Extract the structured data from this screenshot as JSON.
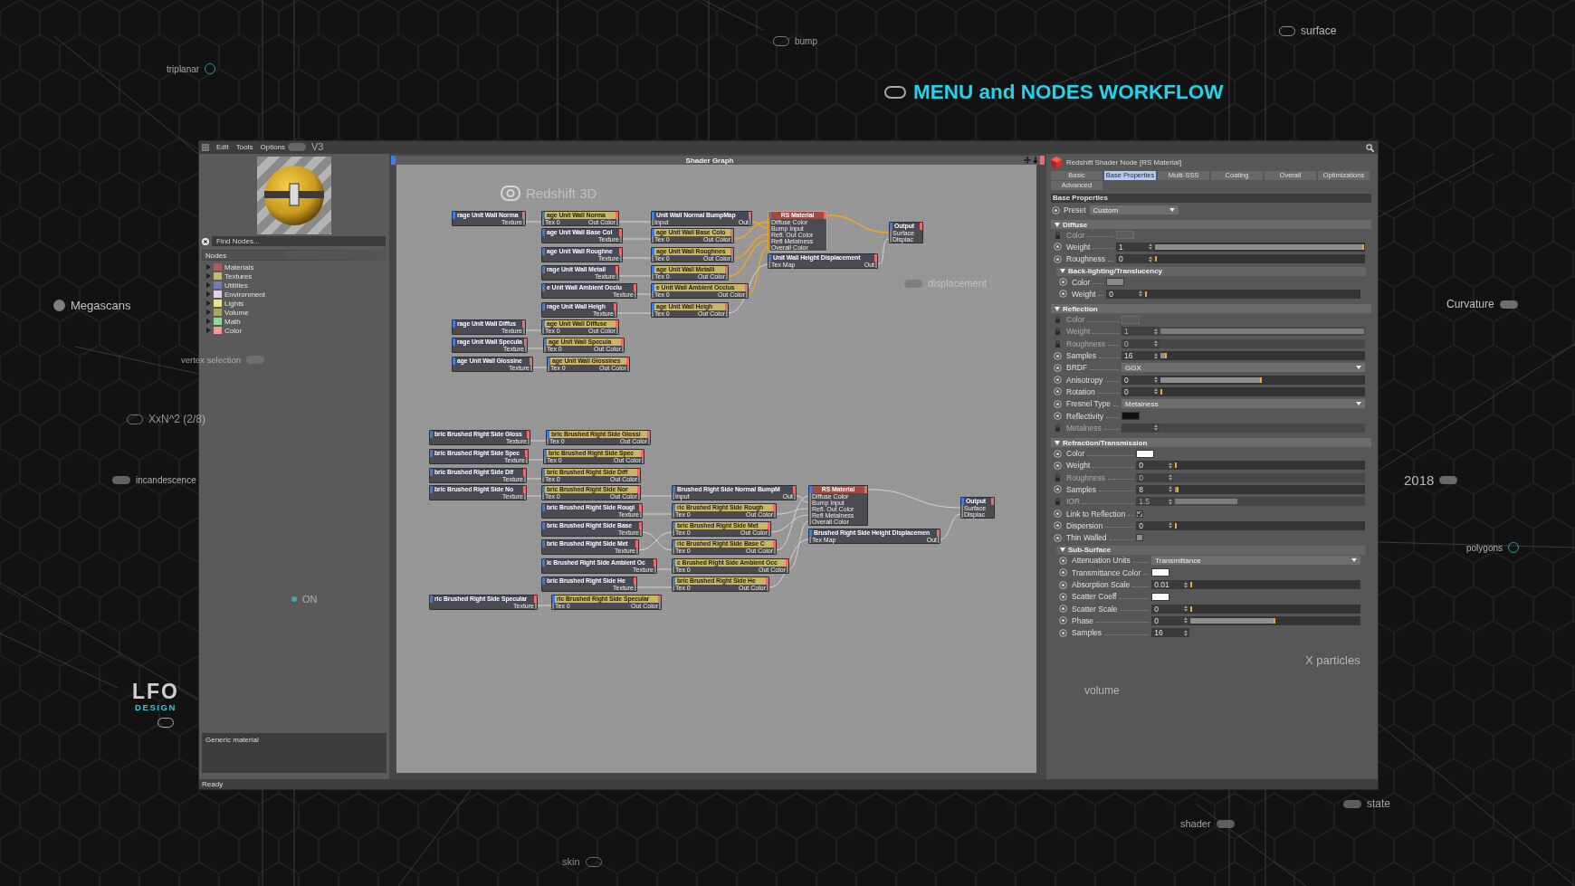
{
  "headline": {
    "text": "MENU and NODES WORKFLOW"
  },
  "labels": [
    {
      "text": "triplanar",
      "kind": "ring"
    },
    {
      "text": "bump",
      "kind": "outline"
    },
    {
      "text": "surface",
      "kind": "outline"
    },
    {
      "text": "Megascans",
      "kind": "dot"
    },
    {
      "text": "Curvature",
      "kind": "pill"
    },
    {
      "text": "vertex selection",
      "kind": "pill"
    },
    {
      "text": "XxN^2 (2/8)",
      "kind": "outline"
    },
    {
      "text": "incandescence",
      "kind": "pill"
    },
    {
      "text": "2018",
      "kind": "pill"
    },
    {
      "text": "polygons",
      "kind": "ring"
    },
    {
      "text": "ON",
      "kind": "spot"
    },
    {
      "text": "shader",
      "kind": "pill"
    },
    {
      "text": "state",
      "kind": "pill"
    },
    {
      "text": "skin",
      "kind": "outline"
    },
    {
      "text": "displacement",
      "kind": "pill"
    },
    {
      "text": "Redshift 3D",
      "kind": "logo"
    },
    {
      "text": "X particles",
      "kind": "plain"
    },
    {
      "text": "volume",
      "kind": "plain"
    },
    {
      "text": "V3",
      "kind": "pill"
    }
  ],
  "logo": {
    "name": "LFO",
    "subtitle": "DESIGN"
  },
  "window": {
    "menu": [
      "Edit",
      "Tools",
      "Options"
    ],
    "left_panel": {
      "search": {
        "placeholder": "Find Nodes..."
      },
      "tree_header": "Nodes",
      "categories": [
        {
          "label": "Materials",
          "color": "#a85c5c",
          "expanded": false
        },
        {
          "label": "Textures",
          "color": "#c8b878",
          "expanded": false
        },
        {
          "label": "Utilities",
          "color": "#7b78b8",
          "expanded": false
        },
        {
          "label": "Environment",
          "color": "#e4cfea",
          "expanded": false
        },
        {
          "label": "Lights",
          "color": "#f2e08a",
          "expanded": false
        },
        {
          "label": "Volume",
          "color": "#a8a266",
          "expanded": false
        },
        {
          "label": "Math",
          "color": "#8fd8a4",
          "expanded": false
        },
        {
          "label": "Color",
          "color": "#ee9a96",
          "expanded": false
        }
      ],
      "description": "Generic material"
    },
    "graph": {
      "title": "Shader Graph",
      "nodes": [
        {
          "title": "rage Unit Wall Norma",
          "kind": "file",
          "selected": false,
          "outputs": [
            "Texture"
          ]
        },
        {
          "title": "age Unit Wall Norma",
          "kind": "texture",
          "selected": false,
          "inputs": [
            "Tex 0"
          ],
          "outputs": [
            "Out Color"
          ]
        },
        {
          "title": "Unit Wall Normal BumpMap",
          "kind": "bump",
          "selected": false,
          "inputs": [
            "Input"
          ],
          "outputs": [
            "Out"
          ]
        },
        {
          "title": "RS Material",
          "kind": "material",
          "selected": true,
          "inputs": [
            "Diffuse Color",
            "Bump Input",
            "Refl. Out Color",
            "Refl Metalness",
            "Overall Color"
          ]
        },
        {
          "title": "age Unit Wall Base Col",
          "kind": "file",
          "selected": false,
          "outputs": [
            "Texture"
          ]
        },
        {
          "title": "age Unit Wall Base Colo",
          "kind": "texture",
          "selected": false,
          "inputs": [
            "Tex 0"
          ],
          "outputs": [
            "Out Color"
          ]
        },
        {
          "title": "Output",
          "kind": "output",
          "selected": false,
          "inputs": [
            "Surface",
            "Displac"
          ]
        },
        {
          "title": "age Unit Wall Roughne",
          "kind": "file",
          "selected": false,
          "outputs": [
            "Texture"
          ]
        },
        {
          "title": "age Unit Wall Roughnes",
          "kind": "texture",
          "selected": false,
          "inputs": [
            "Tex 0"
          ],
          "outputs": [
            "Out Color"
          ]
        },
        {
          "title": "Unit Wall Height Displacement",
          "kind": "displacement",
          "selected": false,
          "inputs": [
            "Tex Map"
          ],
          "outputs": [
            "Out"
          ]
        },
        {
          "title": "rage Unit Wall Metall",
          "kind": "file",
          "selected": false,
          "outputs": [
            "Texture"
          ]
        },
        {
          "title": "age Unit Wall Metalli",
          "kind": "texture",
          "selected": false,
          "inputs": [
            "Tex 0"
          ],
          "outputs": [
            "Out Color"
          ]
        },
        {
          "title": "e Unit Wall Ambient Occlu",
          "kind": "file",
          "selected": false,
          "outputs": [
            "Texture"
          ]
        },
        {
          "title": "e Unit Wall Ambient Occlus",
          "kind": "texture",
          "selected": false,
          "inputs": [
            "Tex 0"
          ],
          "outputs": [
            "Out Color"
          ]
        },
        {
          "title": "rage Unit Wall Heigh",
          "kind": "file",
          "selected": false,
          "outputs": [
            "Texture"
          ]
        },
        {
          "title": "age Unit Wall Heigh",
          "kind": "texture",
          "selected": false,
          "inputs": [
            "Tex 0"
          ],
          "outputs": [
            "Out Color"
          ]
        },
        {
          "title": "rage Unit Wall Diffus",
          "kind": "file",
          "selected": false,
          "outputs": [
            "Texture"
          ]
        },
        {
          "title": "age Unit Wall Diffuse",
          "kind": "texture",
          "selected": false,
          "inputs": [
            "Tex 0"
          ],
          "outputs": [
            "Out Color"
          ]
        },
        {
          "title": "rage Unit Wall Specula",
          "kind": "file",
          "selected": false,
          "outputs": [
            "Texture"
          ]
        },
        {
          "title": "age Unit Wall Specula",
          "kind": "texture",
          "selected": false,
          "inputs": [
            "Tex 0"
          ],
          "outputs": [
            "Out Color"
          ]
        },
        {
          "title": "age Unit Wall Glossine",
          "kind": "file",
          "selected": false,
          "outputs": [
            "Texture"
          ]
        },
        {
          "title": "age Unit Wall Glossines",
          "kind": "texture",
          "selected": false,
          "inputs": [
            "Tex 0"
          ],
          "outputs": [
            "Out Color"
          ]
        },
        {
          "title": "bric Brushed Right Side Gloss",
          "kind": "file",
          "selected": false,
          "outputs": [
            "Texture"
          ]
        },
        {
          "title": "bric Brushed Right Side Glossi",
          "kind": "texture",
          "selected": false,
          "inputs": [
            "Tex 0"
          ],
          "outputs": [
            "Out Color"
          ]
        },
        {
          "title": "bric Brushed Right Side Spec",
          "kind": "file",
          "selected": false,
          "outputs": [
            "Texture"
          ]
        },
        {
          "title": "bric Brushed Right Side Spec",
          "kind": "texture",
          "selected": false,
          "inputs": [
            "Tex 0"
          ],
          "outputs": [
            "Out Color"
          ]
        },
        {
          "title": "bric Brushed Right Side Dif",
          "kind": "file",
          "selected": false,
          "outputs": [
            "Texture"
          ]
        },
        {
          "title": "bric Brushed Right Side Diff",
          "kind": "texture",
          "selected": false,
          "inputs": [
            "Tex 0"
          ],
          "outputs": [
            "Out Color"
          ]
        },
        {
          "title": "bric Brushed Right Side No",
          "kind": "file",
          "selected": false,
          "outputs": [
            "Texture"
          ]
        },
        {
          "title": "bric Brushed Right Side Nor",
          "kind": "texture",
          "selected": false,
          "inputs": [
            "Tex 0"
          ],
          "outputs": [
            "Out Color"
          ]
        },
        {
          "title": "Brushed Right Side Normal BumpM",
          "kind": "bump",
          "selected": false,
          "inputs": [
            "Input"
          ],
          "outputs": [
            "Out"
          ]
        },
        {
          "title": "RS Material",
          "kind": "material",
          "selected": false,
          "inputs": [
            "Diffuse Color",
            "Bump Input",
            "Refl. Out Color",
            "Refl Metalness",
            "Overall Color"
          ]
        },
        {
          "title": "bric Brushed Right Side Rougl",
          "kind": "file",
          "selected": false,
          "outputs": [
            "Texture"
          ]
        },
        {
          "title": "ric Brushed Right Side Rough",
          "kind": "texture",
          "selected": false,
          "inputs": [
            "Tex 0"
          ],
          "outputs": [
            "Out Color"
          ]
        },
        {
          "title": "Output",
          "kind": "output",
          "selected": false,
          "inputs": [
            "Surface",
            "Displac"
          ]
        },
        {
          "title": "bric Brushed Right Side Base",
          "kind": "file",
          "selected": false,
          "outputs": [
            "Texture"
          ]
        },
        {
          "title": "bric Brushed Right Side Met",
          "kind": "texture",
          "selected": false,
          "inputs": [
            "Tex 0"
          ],
          "outputs": [
            "Out Color"
          ]
        },
        {
          "title": "Brushed Right Side Height Displacemen",
          "kind": "displacement",
          "selected": false,
          "inputs": [
            "Tex Map"
          ],
          "outputs": [
            "Out"
          ]
        },
        {
          "title": "bric Brushed Right Side Met",
          "kind": "file",
          "selected": false,
          "outputs": [
            "Texture"
          ]
        },
        {
          "title": "ric Brushed Right Side Base C",
          "kind": "texture",
          "selected": false,
          "inputs": [
            "Tex 0"
          ],
          "outputs": [
            "Out Color"
          ]
        },
        {
          "title": "ic Brushed Right Side Ambient Oc",
          "kind": "file",
          "selected": false,
          "outputs": [
            "Texture"
          ]
        },
        {
          "title": "c Brushed Right Side Ambient Occ",
          "kind": "texture",
          "selected": false,
          "inputs": [
            "Tex 0"
          ],
          "outputs": [
            "Out Color"
          ]
        },
        {
          "title": "bric Brushed Right Side He",
          "kind": "file",
          "selected": false,
          "outputs": [
            "Texture"
          ]
        },
        {
          "title": "bric Brushed Right Side He",
          "kind": "texture",
          "selected": false,
          "inputs": [
            "Tex 0"
          ],
          "outputs": [
            "Out Color"
          ]
        },
        {
          "title": "ric Brushed Right Side Specular",
          "kind": "file",
          "selected": false,
          "outputs": [
            "Texture"
          ]
        },
        {
          "title": "ric Brushed Right Side Specular",
          "kind": "texture",
          "selected": false,
          "inputs": [
            "Tex 0"
          ],
          "outputs": [
            "Out Color"
          ]
        }
      ]
    },
    "inspector": {
      "title": "Redshift Shader Node [RS Material]",
      "tabs": [
        {
          "label": "Basic",
          "selected": false
        },
        {
          "label": "Base Properties",
          "selected": true
        },
        {
          "label": "Multi-SSS",
          "selected": false
        },
        {
          "label": "Coating",
          "selected": false
        },
        {
          "label": "Overall",
          "selected": false
        },
        {
          "label": "Optimizations",
          "selected": false
        },
        {
          "label": "Advanced",
          "selected": false
        }
      ],
      "section": "Base Properties",
      "preset": {
        "label": "Preset",
        "value": "Custom"
      },
      "groups": [
        {
          "title": "Diffuse",
          "expanded": true,
          "rows": [
            {
              "kind": "swatch",
              "label": "Color",
              "color": "#5c5c5c",
              "disabled": true
            },
            {
              "kind": "slider",
              "label": "Weight",
              "value": "1",
              "level": 1,
              "disabled": false
            },
            {
              "kind": "slider",
              "label": "Roughness",
              "value": "0",
              "level": 0,
              "disabled": false
            }
          ],
          "children": [
            {
              "title": "Back-lighting/Translucency",
              "expanded": true,
              "rows": [
                {
                  "kind": "swatch",
                  "label": "Color",
                  "color": "#8a8a8a",
                  "disabled": false
                },
                {
                  "kind": "slider",
                  "label": "Weight",
                  "value": "0",
                  "level": 0,
                  "disabled": false
                }
              ]
            }
          ]
        },
        {
          "title": "Reflection",
          "expanded": true,
          "rows": [
            {
              "kind": "swatch",
              "label": "Color",
              "color": "#5a5a5a",
              "disabled": true
            },
            {
              "kind": "slider",
              "label": "Weight",
              "value": "1",
              "level": 1,
              "disabled": true
            },
            {
              "kind": "slider",
              "label": "Roughness",
              "value": "0",
              "disabled": true
            },
            {
              "kind": "slider",
              "label": "Samples",
              "value": "16",
              "level": 0.03,
              "disabled": false
            },
            {
              "kind": "dropdown",
              "label": "BRDF",
              "value": "GGX",
              "disabled": false
            },
            {
              "kind": "slider",
              "label": "Anisotropy",
              "value": "0",
              "level": 0.5,
              "disabled": false
            },
            {
              "kind": "slider",
              "label": "Rotation",
              "value": "0",
              "level": 0,
              "disabled": false
            },
            {
              "kind": "dropdown",
              "label": "Fresnel Type",
              "value": "Metalness",
              "disabled": false
            },
            {
              "kind": "swatch",
              "label": "Reflectivity",
              "color": "#111111",
              "disabled": false
            },
            {
              "kind": "slider",
              "label": "Metalness",
              "disabled": true
            }
          ]
        },
        {
          "title": "Refraction/Transmission",
          "expanded": true,
          "rows": [
            {
              "kind": "swatch",
              "label": "Color",
              "color": "#ffffff",
              "disabled": false
            },
            {
              "kind": "slider",
              "label": "Weight",
              "value": "0",
              "level": 0,
              "disabled": false
            },
            {
              "kind": "slider",
              "label": "Roughness",
              "value": "0",
              "disabled": true
            },
            {
              "kind": "slider",
              "label": "Samples",
              "value": "8",
              "level": 0.02,
              "disabled": false
            },
            {
              "kind": "slider",
              "label": "IOR",
              "value": "1.5",
              "level": 0.33,
              "disabled": true
            },
            {
              "kind": "checkbox",
              "label": "Link to Reflection",
              "checked": true,
              "disabled": false
            },
            {
              "kind": "slider",
              "label": "Dispersion",
              "value": "0",
              "level": 0,
              "disabled": false
            },
            {
              "kind": "checkbox",
              "label": "Thin Walled",
              "checked": false,
              "disabled": false
            }
          ],
          "children": [
            {
              "title": "Sub-Surface",
              "expanded": true,
              "rows": [
                {
                  "kind": "dropdown",
                  "label": "Attenuation Units",
                  "value": "Transmittance",
                  "disabled": false
                },
                {
                  "kind": "swatch",
                  "label": "Transmittance Color",
                  "color": "#ffffff",
                  "disabled": false
                },
                {
                  "kind": "slider",
                  "label": "Absorption Scale",
                  "value": "0.01",
                  "level": 0,
                  "disabled": false
                },
                {
                  "kind": "swatch",
                  "label": "Scatter Coeff",
                  "color": "#ffffff",
                  "disabled": false
                },
                {
                  "kind": "slider",
                  "label": "Scatter Scale",
                  "value": "0",
                  "level": 0,
                  "disabled": false
                },
                {
                  "kind": "slider",
                  "label": "Phase",
                  "value": "0",
                  "level": 0.5,
                  "disabled": false
                },
                {
                  "kind": "number",
                  "label": "Samples",
                  "value": "16",
                  "disabled": false
                }
              ]
            }
          ]
        }
      ]
    },
    "status": "Ready"
  }
}
